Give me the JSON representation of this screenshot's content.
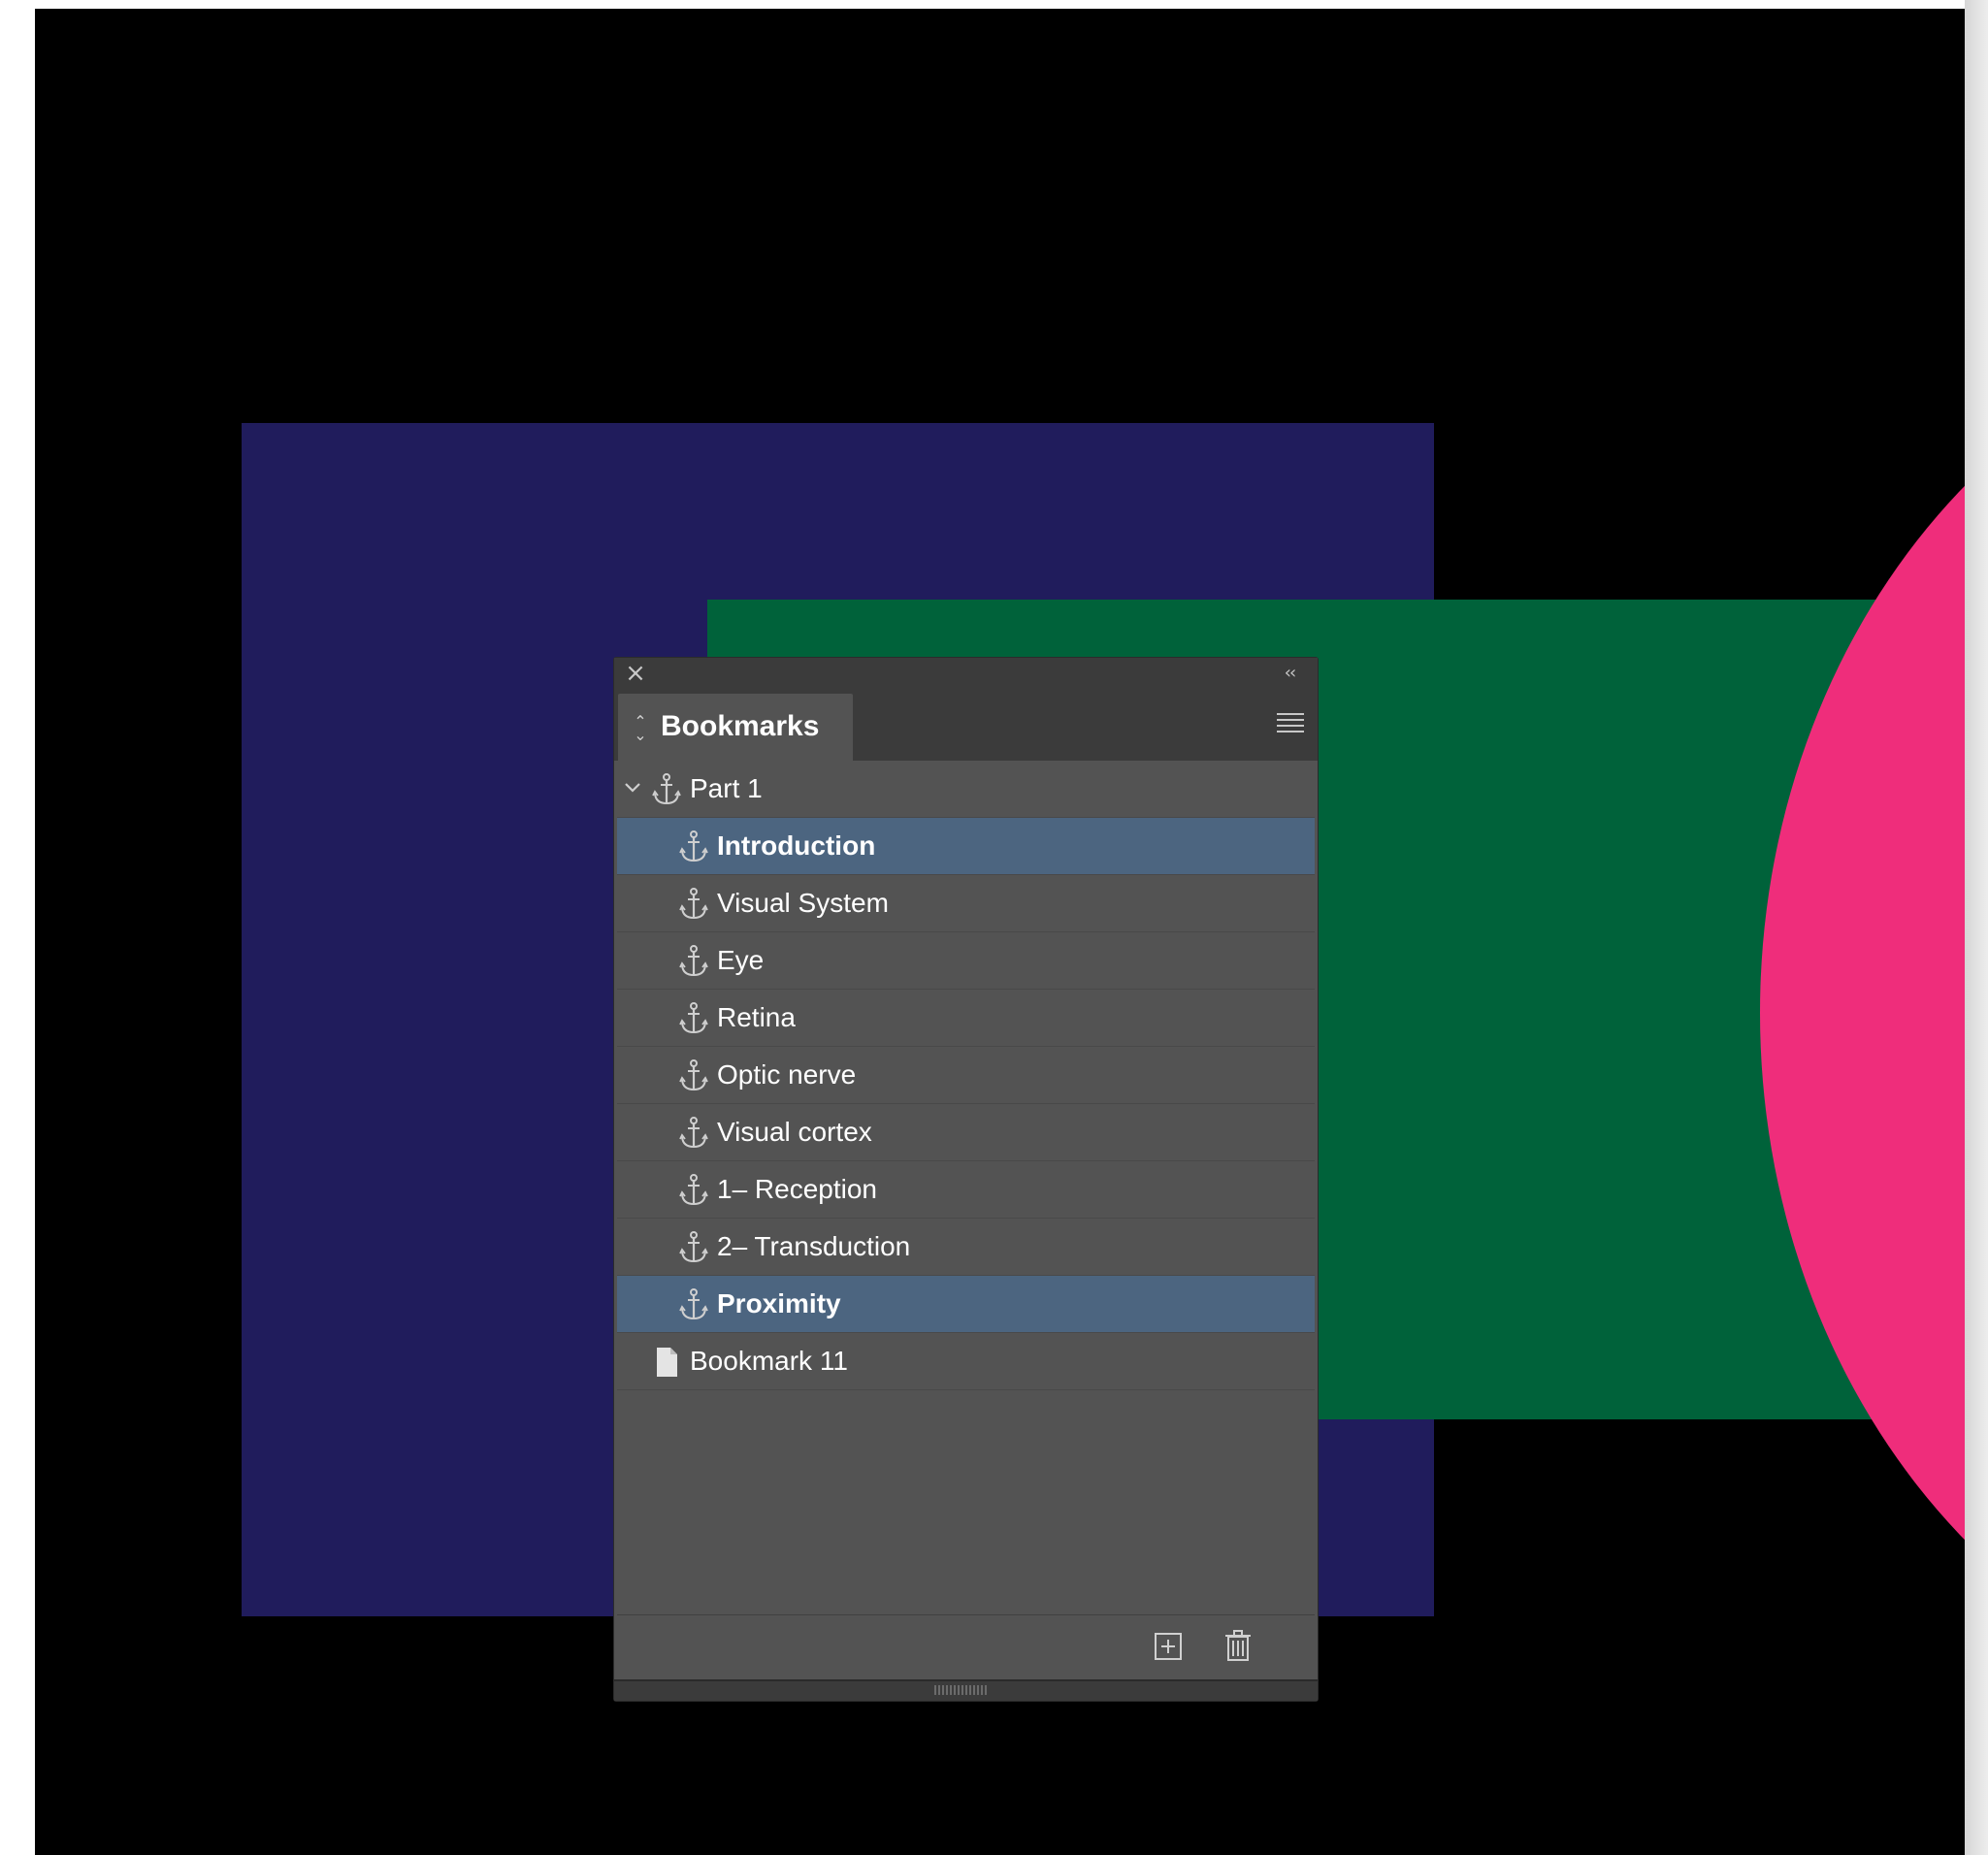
{
  "colors": {
    "page_bg": "#ffffff",
    "artboard": "#000000",
    "navy_rect": "#201c5c",
    "green_rect": "#00623a",
    "pink_circle": "#ef2d7b",
    "panel_bg": "#535353",
    "selection": "#4c6580"
  },
  "panel": {
    "close_icon": "close-icon",
    "collapse_icon": "double-chevron-left-icon",
    "tab_title": "Bookmarks",
    "menu_icon": "hamburger-menu-icon",
    "items": [
      {
        "label": "Part 1",
        "icon": "anchor-icon",
        "level": 0,
        "expanded": true,
        "selected": false
      },
      {
        "label": "Introduction",
        "icon": "anchor-icon",
        "level": 1,
        "selected": true
      },
      {
        "label": "Visual System",
        "icon": "anchor-icon",
        "level": 1,
        "selected": false
      },
      {
        "label": "Eye",
        "icon": "anchor-icon",
        "level": 1,
        "selected": false
      },
      {
        "label": "Retina",
        "icon": "anchor-icon",
        "level": 1,
        "selected": false
      },
      {
        "label": "Optic nerve",
        "icon": "anchor-icon",
        "level": 1,
        "selected": false
      },
      {
        "label": "Visual cortex",
        "icon": "anchor-icon",
        "level": 1,
        "selected": false
      },
      {
        "label": "1– Reception",
        "icon": "anchor-icon",
        "level": 1,
        "selected": false
      },
      {
        "label": "2– Transduction",
        "icon": "anchor-icon",
        "level": 1,
        "selected": false
      },
      {
        "label": "Proximity",
        "icon": "anchor-icon",
        "level": 1,
        "selected": true
      },
      {
        "label": "Bookmark 11",
        "icon": "page-icon",
        "level": 0,
        "selected": false
      }
    ],
    "footer": {
      "new_icon": "new-bookmark-icon",
      "delete_icon": "trash-icon"
    }
  }
}
